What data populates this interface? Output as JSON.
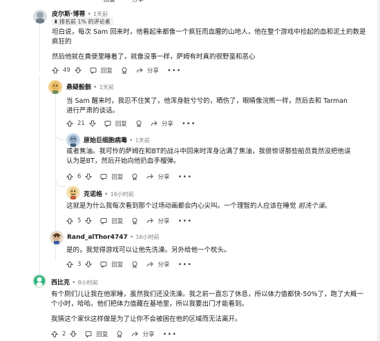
{
  "header": {
    "reply_label": "回复",
    "share_label": "分享"
  },
  "comments": [
    {
      "username": "皮尔斯·博蒂",
      "time": "1天前",
      "flair": "排名前 1% 的评论者",
      "body": [
        "坦白说，每次 Sam 回来时，他看起来都像一个疯狂而血腥的山地人，他在整个游戏中捡起的血和泥土的数是疯狂的",
        "然后他就在粪便里睡着了，就像没事一样，萨姆有时真的很野蛮和恶心"
      ],
      "votes": "49",
      "reply": "回复",
      "share": "分享"
    },
    {
      "username": "悬疑骰骸",
      "time": "1天前",
      "body": [
        "当 Sam 醒来时，我忍不住笑了，他浑身脏兮兮的，晒伤了，眼睛像浣熊一样，然后去和 Tarman 进行严肃的谈话。"
      ],
      "votes": "21",
      "reply": "回复",
      "share": "分享"
    },
    {
      "username": "原始巨细胞病毒",
      "time": "1天前",
      "body": [
        "或者焦油。我可怜的萨姆在和BT的战斗中回来时浑身沾满了焦油，我很惊讶那些船员竟然没把他误认为是BT，然后开始向他扔血手榴弹。"
      ],
      "votes": "6",
      "reply": "回复",
      "share": "分享"
    },
    {
      "username": "克诺格",
      "time": "16小时前",
      "body_prefix": "这就是为什么我每次看到那个过场动画都会内心尖叫。一个理智的人应该在睡觉 ",
      "body_italic": "前洗个澡",
      "body_suffix": "。",
      "votes": "5",
      "reply": "回复",
      "share": "分享"
    },
    {
      "username": "Rand_alThor4747",
      "time": "16小时前",
      "body": [
        "是的，我觉得游戏可以让他先洗澡。另外给他一个枕头。"
      ],
      "votes": "3",
      "reply": "回复",
      "share": "分享"
    },
    {
      "username": "西比克",
      "time": "8小时前",
      "body": [
        "有个厕们儿让我在他家睡，虽然我们还没洗澡。我之前一直忘了休息，所以体力值都快-50%了，跑了大概一个小时，哈哈。他们把体力值藏在基地里，所以我要出门才能看到。",
        "我猜这个家伙这样做是为了让你不会被困在他的区域而无法离开。"
      ],
      "votes": "2",
      "reply": "回复",
      "share": "分享"
    }
  ]
}
